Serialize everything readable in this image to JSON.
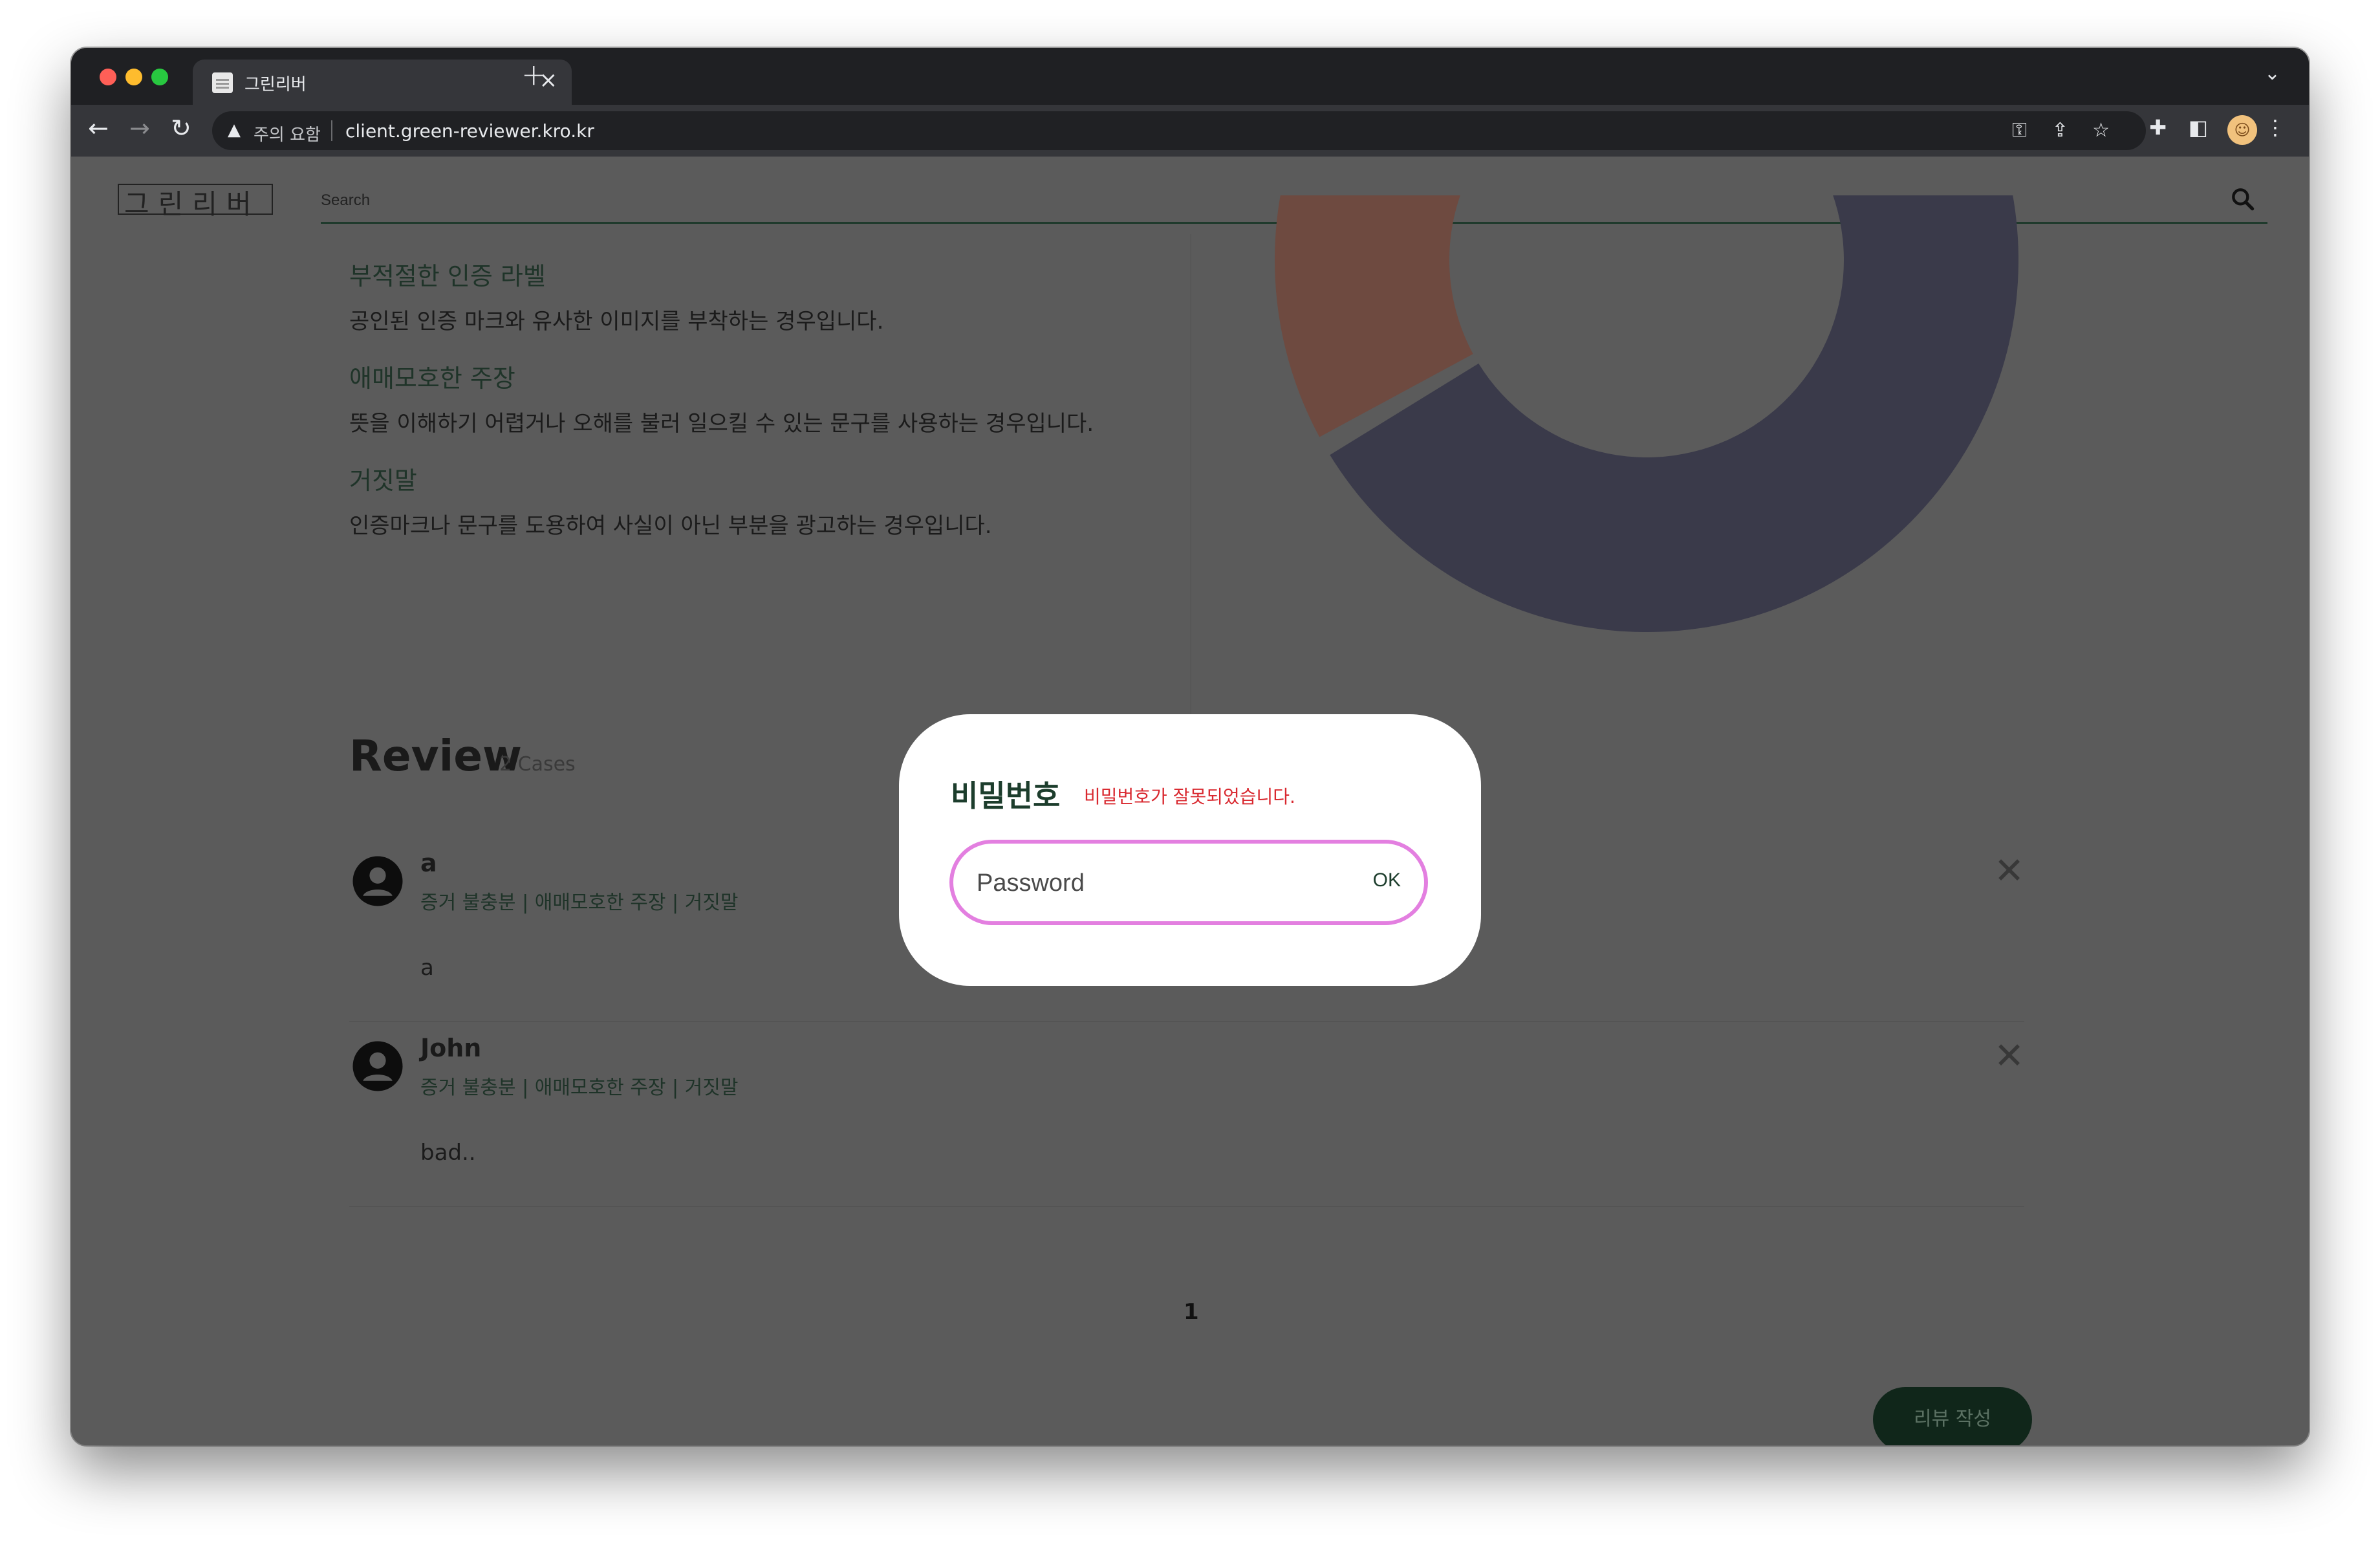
{
  "browser": {
    "tab_title": "그린리버",
    "security_label": "주의 요함",
    "url": "client.green-reviewer.kro.kr",
    "new_tab_glyph": "+",
    "tab_close_glyph": "×"
  },
  "header": {
    "logo_text": "그린리버",
    "search_placeholder": "Search"
  },
  "issues": [
    {
      "title": "부적절한 인증 라벨",
      "description": "공인된 인증 마크와 유사한 이미지를 부착하는 경우입니다."
    },
    {
      "title": "애매모호한 주장",
      "description": "뜻을 이해하기 어렵거나 오해를 불러 일으킬 수 있는 문구를 사용하는 경우입니다."
    },
    {
      "title": "거짓말",
      "description": "인증마크나 문구를 도용하여 사실이 아닌 부분을 광고하는 경우입니다."
    }
  ],
  "chart_data": {
    "type": "pie",
    "slices": [
      {
        "value": 1,
        "color": "#7a7a3c"
      },
      {
        "value": 3,
        "color": "#3a3a4a"
      },
      {
        "value": 2,
        "color": "#6e4a40"
      }
    ]
  },
  "reviews": {
    "title": "Review",
    "count_label": "2 Cases",
    "items": [
      {
        "name": "a",
        "tags": "증거 불충분 | 애매모호한 주장 | 거짓말",
        "body": "a"
      },
      {
        "name": "John",
        "tags": "증거 불충분 | 애매모호한 주장 | 거짓말",
        "body": "bad.."
      }
    ],
    "delete_glyph": "✕"
  },
  "pagination": {
    "current": "1"
  },
  "write_button_label": "리뷰 작성",
  "modal": {
    "title": "비밀번호",
    "error": "비밀번호가 잘못되었습니다.",
    "input_placeholder": "Password",
    "ok_label": "OK"
  },
  "colors": {
    "brand_green": "#1c3d2c",
    "error_red": "#d9282f",
    "focus_pink": "#e37fe0"
  }
}
